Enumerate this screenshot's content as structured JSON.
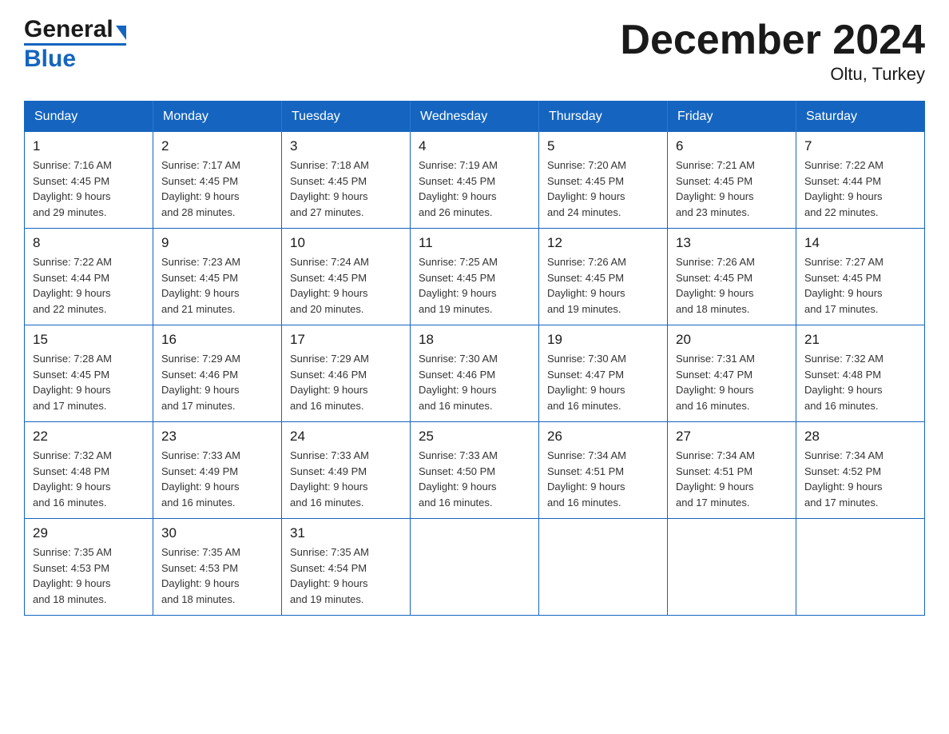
{
  "header": {
    "logo_general": "General",
    "logo_blue": "Blue",
    "month_title": "December 2024",
    "location": "Oltu, Turkey"
  },
  "weekdays": [
    "Sunday",
    "Monday",
    "Tuesday",
    "Wednesday",
    "Thursday",
    "Friday",
    "Saturday"
  ],
  "weeks": [
    [
      {
        "day": "1",
        "sunrise": "7:16 AM",
        "sunset": "4:45 PM",
        "daylight": "9 hours and 29 minutes."
      },
      {
        "day": "2",
        "sunrise": "7:17 AM",
        "sunset": "4:45 PM",
        "daylight": "9 hours and 28 minutes."
      },
      {
        "day": "3",
        "sunrise": "7:18 AM",
        "sunset": "4:45 PM",
        "daylight": "9 hours and 27 minutes."
      },
      {
        "day": "4",
        "sunrise": "7:19 AM",
        "sunset": "4:45 PM",
        "daylight": "9 hours and 26 minutes."
      },
      {
        "day": "5",
        "sunrise": "7:20 AM",
        "sunset": "4:45 PM",
        "daylight": "9 hours and 24 minutes."
      },
      {
        "day": "6",
        "sunrise": "7:21 AM",
        "sunset": "4:45 PM",
        "daylight": "9 hours and 23 minutes."
      },
      {
        "day": "7",
        "sunrise": "7:22 AM",
        "sunset": "4:44 PM",
        "daylight": "9 hours and 22 minutes."
      }
    ],
    [
      {
        "day": "8",
        "sunrise": "7:22 AM",
        "sunset": "4:44 PM",
        "daylight": "9 hours and 22 minutes."
      },
      {
        "day": "9",
        "sunrise": "7:23 AM",
        "sunset": "4:45 PM",
        "daylight": "9 hours and 21 minutes."
      },
      {
        "day": "10",
        "sunrise": "7:24 AM",
        "sunset": "4:45 PM",
        "daylight": "9 hours and 20 minutes."
      },
      {
        "day": "11",
        "sunrise": "7:25 AM",
        "sunset": "4:45 PM",
        "daylight": "9 hours and 19 minutes."
      },
      {
        "day": "12",
        "sunrise": "7:26 AM",
        "sunset": "4:45 PM",
        "daylight": "9 hours and 19 minutes."
      },
      {
        "day": "13",
        "sunrise": "7:26 AM",
        "sunset": "4:45 PM",
        "daylight": "9 hours and 18 minutes."
      },
      {
        "day": "14",
        "sunrise": "7:27 AM",
        "sunset": "4:45 PM",
        "daylight": "9 hours and 17 minutes."
      }
    ],
    [
      {
        "day": "15",
        "sunrise": "7:28 AM",
        "sunset": "4:45 PM",
        "daylight": "9 hours and 17 minutes."
      },
      {
        "day": "16",
        "sunrise": "7:29 AM",
        "sunset": "4:46 PM",
        "daylight": "9 hours and 17 minutes."
      },
      {
        "day": "17",
        "sunrise": "7:29 AM",
        "sunset": "4:46 PM",
        "daylight": "9 hours and 16 minutes."
      },
      {
        "day": "18",
        "sunrise": "7:30 AM",
        "sunset": "4:46 PM",
        "daylight": "9 hours and 16 minutes."
      },
      {
        "day": "19",
        "sunrise": "7:30 AM",
        "sunset": "4:47 PM",
        "daylight": "9 hours and 16 minutes."
      },
      {
        "day": "20",
        "sunrise": "7:31 AM",
        "sunset": "4:47 PM",
        "daylight": "9 hours and 16 minutes."
      },
      {
        "day": "21",
        "sunrise": "7:32 AM",
        "sunset": "4:48 PM",
        "daylight": "9 hours and 16 minutes."
      }
    ],
    [
      {
        "day": "22",
        "sunrise": "7:32 AM",
        "sunset": "4:48 PM",
        "daylight": "9 hours and 16 minutes."
      },
      {
        "day": "23",
        "sunrise": "7:33 AM",
        "sunset": "4:49 PM",
        "daylight": "9 hours and 16 minutes."
      },
      {
        "day": "24",
        "sunrise": "7:33 AM",
        "sunset": "4:49 PM",
        "daylight": "9 hours and 16 minutes."
      },
      {
        "day": "25",
        "sunrise": "7:33 AM",
        "sunset": "4:50 PM",
        "daylight": "9 hours and 16 minutes."
      },
      {
        "day": "26",
        "sunrise": "7:34 AM",
        "sunset": "4:51 PM",
        "daylight": "9 hours and 16 minutes."
      },
      {
        "day": "27",
        "sunrise": "7:34 AM",
        "sunset": "4:51 PM",
        "daylight": "9 hours and 17 minutes."
      },
      {
        "day": "28",
        "sunrise": "7:34 AM",
        "sunset": "4:52 PM",
        "daylight": "9 hours and 17 minutes."
      }
    ],
    [
      {
        "day": "29",
        "sunrise": "7:35 AM",
        "sunset": "4:53 PM",
        "daylight": "9 hours and 18 minutes."
      },
      {
        "day": "30",
        "sunrise": "7:35 AM",
        "sunset": "4:53 PM",
        "daylight": "9 hours and 18 minutes."
      },
      {
        "day": "31",
        "sunrise": "7:35 AM",
        "sunset": "4:54 PM",
        "daylight": "9 hours and 19 minutes."
      },
      null,
      null,
      null,
      null
    ]
  ],
  "labels": {
    "sunrise": "Sunrise:",
    "sunset": "Sunset:",
    "daylight": "Daylight:"
  },
  "colors": {
    "header_bg": "#1565c0",
    "border": "#1565c0"
  }
}
